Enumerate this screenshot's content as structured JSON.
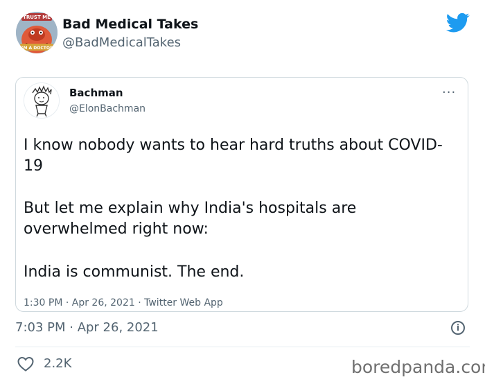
{
  "tweet": {
    "author_name": "Bad Medical Takes",
    "author_handle": "@BadMedicalTakes",
    "avatar_text_top": "TRUST ME",
    "avatar_text_bottom": "I'M A DOCTOR",
    "timestamp": "7:03 PM · Apr 26, 2021",
    "likes": "2.2K",
    "icons": {
      "brand": "twitter-bird-icon",
      "info": "info-icon",
      "like": "heart-icon"
    },
    "colors": {
      "brand": "#1d9bf0",
      "secondary_text": "#536471",
      "border": "#cfd9de"
    }
  },
  "quoted": {
    "author_name": "Bachman",
    "author_handle": "@ElonBachman",
    "lines": [
      "I know nobody wants to hear hard truths about COVID-",
      "19",
      "But let me explain why India's hospitals are",
      "overwhelmed right now:",
      "India is communist. The end."
    ],
    "meta": "1:30 PM · Apr 26, 2021 · Twitter Web App",
    "more_icon": "more-horizontal-icon",
    "more_glyph": "···"
  },
  "info_glyph": "i",
  "watermark": "boredpanda.com"
}
